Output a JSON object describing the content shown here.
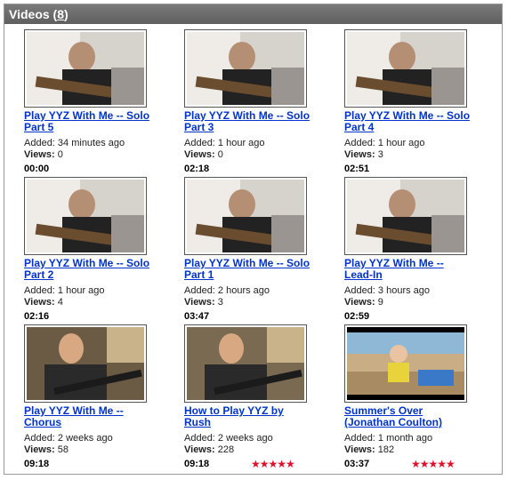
{
  "panel": {
    "title": "Videos",
    "count": "8"
  },
  "colors": {
    "header_bg": "#666666",
    "link": "#0033cc",
    "star": "#e0102c"
  },
  "videos": [
    {
      "title": "Play YYZ With Me -- Solo Part 5",
      "added": "Added: 34 minutes ago",
      "views_label": "Views:",
      "views": "0",
      "duration": "00:00",
      "rating": 0
    },
    {
      "title": "Play YYZ With Me -- Solo Part 3",
      "added": "Added: 1 hour ago",
      "views_label": "Views:",
      "views": "0",
      "duration": "02:18",
      "rating": 0
    },
    {
      "title": "Play YYZ With Me -- Solo Part 4",
      "added": "Added: 1 hour ago",
      "views_label": "Views:",
      "views": "3",
      "duration": "02:51",
      "rating": 0
    },
    {
      "title": "Play YYZ With Me -- Solo Part 2",
      "added": "Added: 1 hour ago",
      "views_label": "Views:",
      "views": "4",
      "duration": "02:16",
      "rating": 0
    },
    {
      "title": "Play YYZ With Me -- Solo Part 1",
      "added": "Added: 2 hours ago",
      "views_label": "Views:",
      "views": "3",
      "duration": "03:47",
      "rating": 0
    },
    {
      "title": "Play YYZ With Me -- Lead-In",
      "added": "Added: 3 hours ago",
      "views_label": "Views:",
      "views": "9",
      "duration": "02:59",
      "rating": 0
    },
    {
      "title": "Play YYZ With Me -- Chorus",
      "added": "Added: 2 weeks ago",
      "views_label": "Views:",
      "views": "58",
      "duration": "09:18",
      "rating": 0
    },
    {
      "title": "How to Play YYZ by Rush",
      "added": "Added: 2 weeks ago",
      "views_label": "Views:",
      "views": "228",
      "duration": "09:18",
      "rating": 5
    },
    {
      "title": "Summer's Over (Jonathan Coulton)",
      "added": "Added: 1 month ago",
      "views_label": "Views:",
      "views": "182",
      "duration": "03:37",
      "rating": 5
    }
  ]
}
